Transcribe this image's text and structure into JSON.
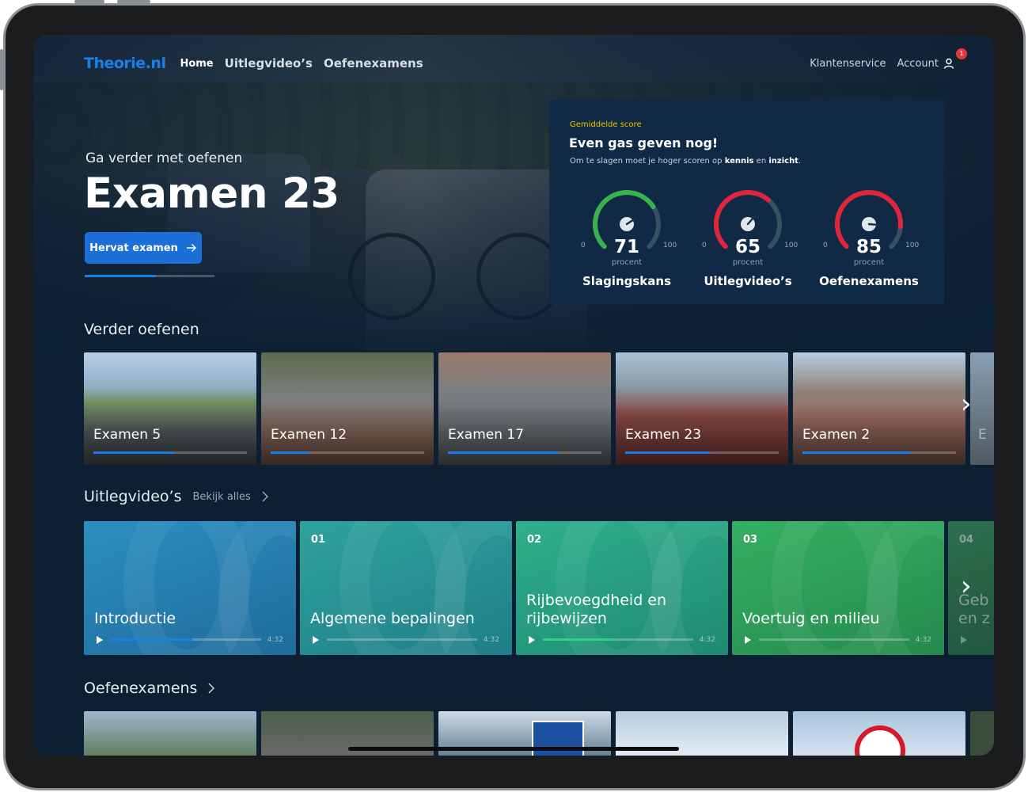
{
  "nav": {
    "logo": "Theorie.nl",
    "links": [
      {
        "label": "Home",
        "active": true
      },
      {
        "label": "Uitlegvideo’s",
        "active": false
      },
      {
        "label": "Oefenexamens",
        "active": false
      }
    ],
    "support_label": "Klantenservice",
    "account_label": "Account",
    "notification_count": "1"
  },
  "hero": {
    "subtitle": "Ga verder met oefenen",
    "title": "Examen 23",
    "resume_button": "Hervat examen",
    "progress": 0.55
  },
  "score": {
    "kicker": "Gemiddelde score",
    "title": "Even gas geven nog!",
    "desc_before": "Om te slagen moet je hoger scoren op ",
    "desc_bold1": "kennis",
    "desc_mid": " en ",
    "desc_bold2": "inzicht",
    "desc_after": ".",
    "gauges": [
      {
        "value": "71",
        "unit": "procent",
        "min": "0",
        "max": "100",
        "label": "Slagingskans",
        "color": "#38b24a"
      },
      {
        "value": "65",
        "unit": "procent",
        "min": "0",
        "max": "100",
        "label": "Uitlegvideo’s",
        "color": "#e0243a"
      },
      {
        "value": "85",
        "unit": "procent",
        "min": "0",
        "max": "100",
        "label": "Oefenexamens",
        "color": "#e0243a"
      }
    ]
  },
  "continue": {
    "title": "Verder oefenen",
    "cards": [
      {
        "label": "Examen 5",
        "progress": 0.52
      },
      {
        "label": "Examen 12",
        "progress": 0.25
      },
      {
        "label": "Examen 17",
        "progress": 0.72
      },
      {
        "label": "Examen 23",
        "progress": 0.55
      },
      {
        "label": "Examen 2",
        "progress": 0.7
      }
    ],
    "peek_label": "E"
  },
  "videos": {
    "title": "Uitlegvideo’s",
    "see_all": "Bekijk alles",
    "cards": [
      {
        "num": "",
        "title": "Introductie",
        "duration": "4:32",
        "progress": 0.54,
        "accent": "#1b7ee8",
        "bg1": "#2b8fc0",
        "bg2": "#1f6c9c"
      },
      {
        "num": "01",
        "title": "Algemene bepalingen",
        "duration": "4:32",
        "progress": 0,
        "accent": "#1b7ee8",
        "bg1": "#2fa39d",
        "bg2": "#1f7e89"
      },
      {
        "num": "02",
        "title": "Rijbevoegdheid en rijbewijzen",
        "duration": "4:32",
        "progress": 0.47,
        "accent": "#2fd08a",
        "bg1": "#2fb08a",
        "bg2": "#1f8a72"
      },
      {
        "num": "03",
        "title": "Voertuig en milieu",
        "duration": "4:32",
        "progress": 0,
        "accent": "#1b7ee8",
        "bg1": "#35b062",
        "bg2": "#248a4e"
      }
    ],
    "peek_num": "04",
    "peek_title": "Geb en z"
  },
  "exams": {
    "title": "Oefenexamens"
  }
}
